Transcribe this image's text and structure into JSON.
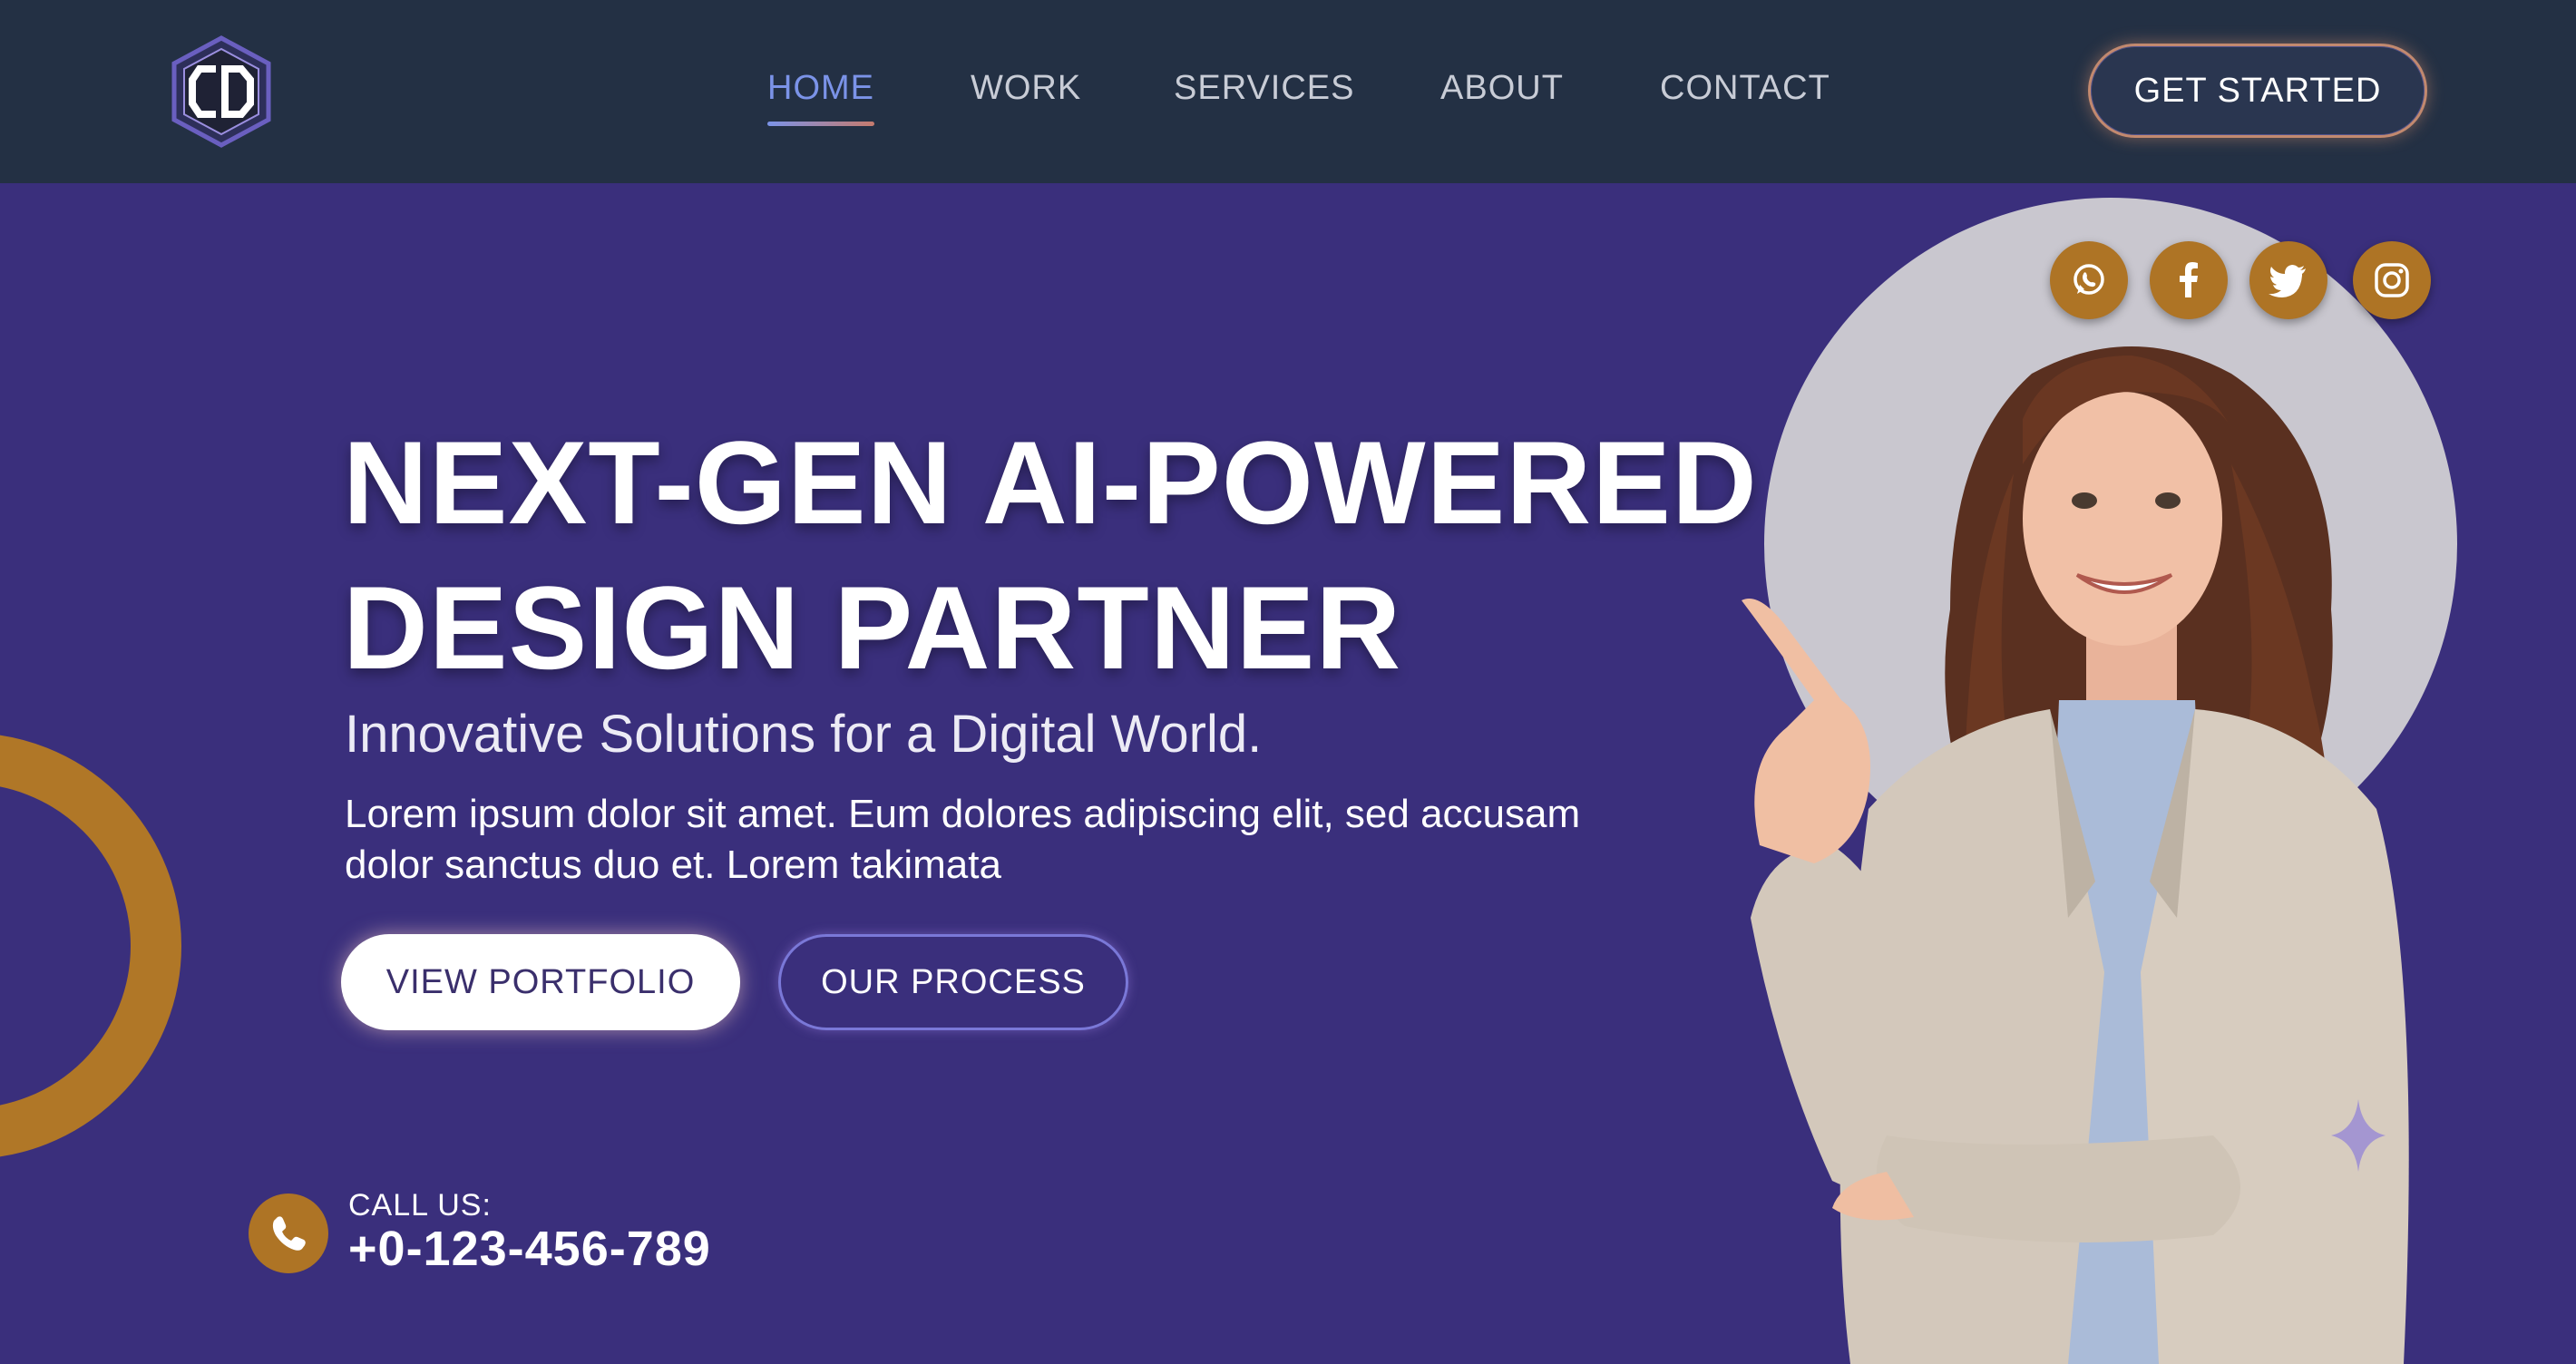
{
  "nav": {
    "logo_icon": "cd-hexagon-logo-icon",
    "links": [
      {
        "label": "HOME",
        "active": true
      },
      {
        "label": "WORK",
        "active": false
      },
      {
        "label": "SERVICES",
        "active": false
      },
      {
        "label": "ABOUT",
        "active": false
      },
      {
        "label": "CONTACT",
        "active": false
      }
    ],
    "cta_label": "GET STARTED"
  },
  "hero": {
    "headline_line1": "NEXT-GEN AI-POWERED",
    "headline_line2": "DESIGN PARTNER",
    "subtitle": "Innovative Solutions for a Digital World.",
    "body": "Lorem ipsum dolor sit amet. Eum dolores adipiscing elit, sed accusam dolor sanctus duo et. Lorem takimata",
    "primary_button": "VIEW PORTFOLIO",
    "secondary_button": "OUR PROCESS"
  },
  "social": [
    {
      "name": "whatsapp-icon"
    },
    {
      "name": "facebook-icon"
    },
    {
      "name": "twitter-icon"
    },
    {
      "name": "instagram-icon"
    }
  ],
  "contact": {
    "label": "CALL US:",
    "phone": "+0-123-456-789",
    "icon": "phone-icon"
  },
  "colors": {
    "navbar_bg": "#233044",
    "hero_bg": "#3a2f7c",
    "accent_gold": "#ae7425",
    "circle_gray": "#c9c7cf",
    "active_link": "#7b93e8"
  }
}
